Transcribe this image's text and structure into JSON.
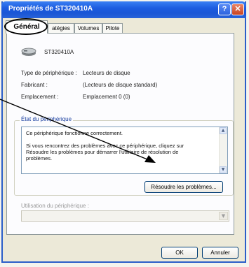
{
  "window": {
    "title": "Propriétés de ST320410A",
    "help_glyph": "?",
    "close_glyph": "✕"
  },
  "tabs": [
    {
      "label": "Général",
      "active": true
    },
    {
      "label": "atégies",
      "active": false
    },
    {
      "label": "Volumes",
      "active": false
    },
    {
      "label": "Pilote",
      "active": false
    }
  ],
  "device": {
    "icon": "hard-disk-icon",
    "name": "ST320410A"
  },
  "properties": [
    {
      "label": "Type de périphérique :",
      "value": "Lecteurs de disque"
    },
    {
      "label": "Fabricant :",
      "value": "(Lecteurs de disque standard)"
    },
    {
      "label": "Emplacement :",
      "value": "Emplacement 0 (0)"
    }
  ],
  "status": {
    "group_title": "État du périphérique",
    "line1": "Ce périphérique fonctionne correctement.",
    "line2": "Si vous rencontrez des problèmes avec ce périphérique, cliquez sur\nRésoudre les problèmes pour démarrer l'utilitaire de résolution de\nproblèmes.",
    "troubleshoot_button": "Résoudre les problèmes..."
  },
  "usage": {
    "label": "Utilisation du périphérique :",
    "selected": ""
  },
  "footer": {
    "ok": "OK",
    "cancel": "Annuler"
  },
  "colors": {
    "titlebar": "#1d5ce0",
    "window_bg": "#ece9d8",
    "annotation": "#000000"
  }
}
